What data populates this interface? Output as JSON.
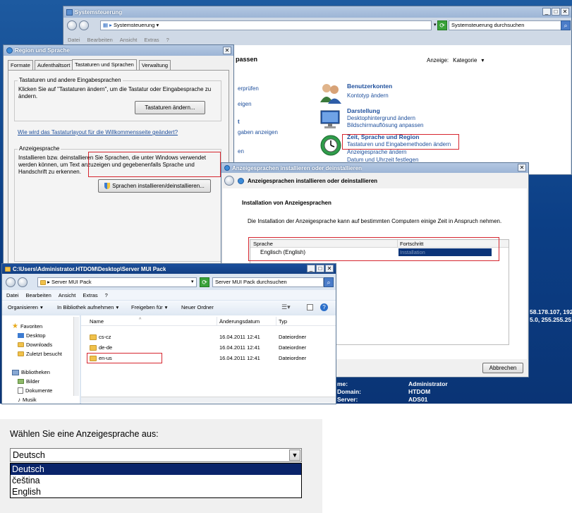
{
  "desktop": {
    "info_labels": [
      "me:",
      "Domain:",
      "Server:"
    ],
    "info_values": [
      "Administrator",
      "HTDOM",
      "ADS01"
    ],
    "ip_lines": [
      "58.178.107, 192",
      "5.0, 255.255.25"
    ]
  },
  "control_panel": {
    "title": "Systemsteuerung",
    "address": "Systemsteuerung",
    "search_placeholder": "Systemsteuerung durchsuchen",
    "menu": [
      "Datei",
      "Bearbeiten",
      "Ansicht",
      "Extras",
      "?"
    ],
    "left_title_fragment": "passen",
    "left_links": [
      "erprüfen",
      "eigen",
      "t",
      "gaben anzeigen",
      "en"
    ],
    "view_label": "Anzeige:",
    "view_value": "Kategorie",
    "categories": [
      {
        "heading": "Benutzerkonten",
        "links": [
          "Kontotyp ändern"
        ]
      },
      {
        "heading": "Darstellung",
        "links": [
          "Desktophintergrund ändern",
          "Bildschirmauflösung anpassen"
        ]
      },
      {
        "heading": "Zeit, Sprache und Region",
        "links": [
          "Tastaturen und Eingabemethoden ändern",
          "Anzeigesprache ändern",
          "Datum und Uhrzeit festlegen"
        ]
      }
    ]
  },
  "region_dialog": {
    "title": "Region und Sprache",
    "tabs": [
      "Formate",
      "Aufenthaltsort",
      "Tastaturen und Sprachen",
      "Verwaltung"
    ],
    "active_tab": 2,
    "group1_title": "Tastaturen und andere Eingabesprachen",
    "group1_text": "Klicken Sie auf \"Tastaturen ändern\", um die Tastatur oder Eingabesprache zu ändern.",
    "keyboards_button": "Tastaturen ändern...",
    "layout_link": "Wie wird das Tastaturlayout für die Willkommensseite geändert?",
    "group2_title": "Anzeigesprache",
    "group2_text": "Installieren bzw. deinstallieren Sie Sprachen, die unter Windows verwendet werden können, um Text anzuzeigen und gegebenenfalls Sprache und Handschrift zu erkennen.",
    "install_button": "Sprachen installieren/deinstallieren..."
  },
  "install_dialog": {
    "title": "Anzeigesprachen installieren oder deinstallieren",
    "header": "Anzeigesprachen installieren oder deinstallieren",
    "subheading": "Installation von Anzeigesprachen",
    "info": "Die Installation der Anzeigesprache kann auf bestimmten Computern einige Zeit in Anspruch nehmen.",
    "columns": [
      "Sprache",
      "Fortschritt"
    ],
    "rows": [
      {
        "language": "Englisch (English)",
        "progress": "Installation"
      }
    ],
    "cancel_button": "Abbrechen"
  },
  "explorer": {
    "title": "C:\\Users\\Administrator.HTDOM\\Desktop\\Server MUI Pack",
    "address": "Server MUI Pack",
    "search_placeholder": "Server MUI Pack durchsuchen",
    "menu": [
      "Datei",
      "Bearbeiten",
      "Ansicht",
      "Extras",
      "?"
    ],
    "toolbar": {
      "organize": "Organisieren",
      "library": "In Bibliothek aufnehmen",
      "share": "Freigeben für",
      "new_folder": "Neuer Ordner"
    },
    "nav": {
      "favorites": "Favoriten",
      "favorites_items": [
        "Desktop",
        "Downloads",
        "Zuletzt besucht"
      ],
      "libraries": "Bibliotheken",
      "libraries_items": [
        "Bilder",
        "Dokumente",
        "Musik"
      ]
    },
    "columns": [
      "Name",
      "Änderungsdatum",
      "Typ"
    ],
    "files": [
      {
        "name": "cs-cz",
        "date": "16.04.2011 12:41",
        "type": "Dateiordner"
      },
      {
        "name": "de-de",
        "date": "16.04.2011 12:41",
        "type": "Dateiordner"
      },
      {
        "name": "en-us",
        "date": "16.04.2011 12:41",
        "type": "Dateiordner"
      }
    ]
  },
  "language_select": {
    "label": "Wählen Sie eine Anzeigesprache aus:",
    "selected": "Deutsch",
    "options": [
      "Deutsch",
      "čeština",
      "English"
    ],
    "highlighted_index": 0
  }
}
